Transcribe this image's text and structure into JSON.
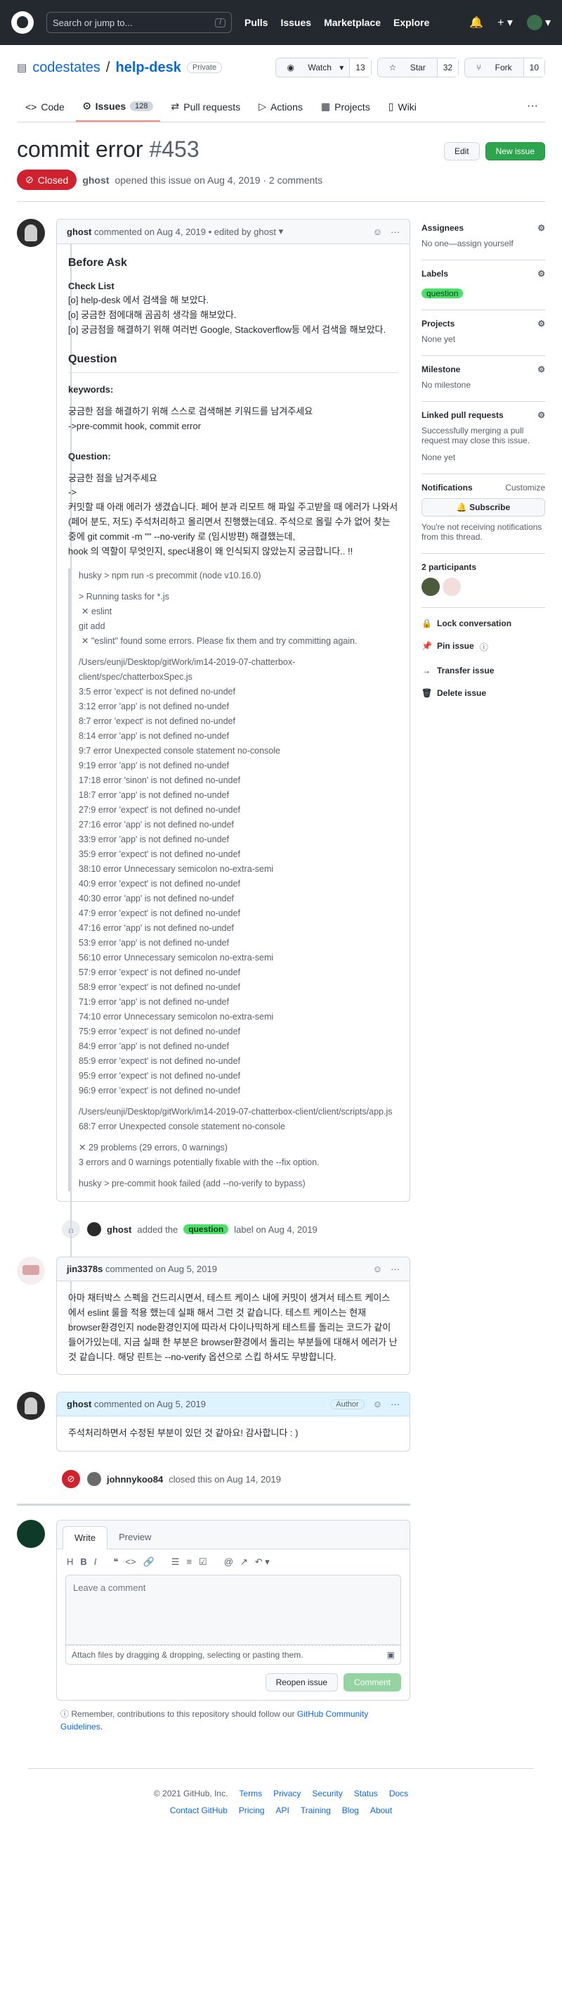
{
  "header": {
    "search_placeholder": "Search or jump to...",
    "search_key": "/",
    "nav": [
      "Pulls",
      "Issues",
      "Marketplace",
      "Explore"
    ]
  },
  "repo": {
    "owner": "codestates",
    "slash": "/",
    "name": "help-desk",
    "visibility": "Private",
    "watch_label": "Watch",
    "watch_count": "13",
    "star_label": "Star",
    "star_count": "32",
    "fork_label": "Fork",
    "fork_count": "10"
  },
  "tabs": [
    {
      "label": "Code",
      "icon": "code-icon"
    },
    {
      "label": "Issues",
      "icon": "issue-icon",
      "count": "128"
    },
    {
      "label": "Pull requests",
      "icon": "pull-request-icon"
    },
    {
      "label": "Actions",
      "icon": "play-icon"
    },
    {
      "label": "Projects",
      "icon": "project-icon"
    },
    {
      "label": "Wiki",
      "icon": "book-icon"
    }
  ],
  "issue": {
    "title": "commit error",
    "number": "#453",
    "edit_label": "Edit",
    "new_label": "New issue",
    "state": "Closed",
    "author": "ghost",
    "opened_text": "opened this issue on Aug 4, 2019 · 2 comments"
  },
  "first_comment": {
    "author": "ghost",
    "header_text": "commented on Aug 4, 2019 • edited by ghost",
    "h_before": "Before Ask",
    "checklist_title": "Check List",
    "checklist": [
      "[o] help-desk 에서 검색을 해 보았다.",
      "[o] 궁금한 점에대해 곰곰히 생각을 해보았다.",
      "[o] 궁금점을 해결하기 위해 여러번 Google, Stackoverflow등 에서 검색을 해보았다."
    ],
    "h_question": "Question",
    "keywords_label": "keywords:",
    "keywords_lines": [
      "궁금한 점을 해결하기 위해 스스로 검색해본 키워드를 남겨주세요",
      "->pre-commit hook, commit error"
    ],
    "question_label": "Question:",
    "question_lines": [
      "궁금한 점을 남겨주세요",
      "->",
      "커밋할 때 아래 에러가 생겼습니다. 페어 분과 리모트 해 파일 주고받을 때 에러가 나와서 (페어 분도, 저도) 주석처리하고 올리면서 진행했는데요. 주석으로 올릴 수가 없어 찾는 중에 git commit -m \"\" --no-verify 로 (임시방편) 해결했는데,",
      "hook 의 역할이 무엇인지, spec내용이 왜 인식되지 않았는지 궁금합니다.. !!"
    ],
    "quote": {
      "cmd": "husky > npm run -s precommit (node v10.16.0)",
      "task_lines": [
        "> Running tasks for *.js",
        "✕ eslint",
        "git add",
        "✕ \"eslint\" found some errors. Please fix them and try committing again."
      ],
      "file1": "/Users/eunji/Desktop/gitWork/im14-2019-07-chatterbox-client/spec/chatterboxSpec.js",
      "errors": [
        "3:5 error 'expect' is not defined no-undef",
        "3:12 error 'app' is not defined no-undef",
        "8:7 error 'expect' is not defined no-undef",
        "8:14 error 'app' is not defined no-undef",
        "9:7 error Unexpected console statement no-console",
        "9:19 error 'app' is not defined no-undef",
        "17:18 error 'sinon' is not defined no-undef",
        "18:7 error 'app' is not defined no-undef",
        "27:9 error 'expect' is not defined no-undef",
        "27:16 error 'app' is not defined no-undef",
        "33:9 error 'app' is not defined no-undef",
        "35:9 error 'expect' is not defined no-undef",
        "38:10 error Unnecessary semicolon no-extra-semi",
        "40:9 error 'expect' is not defined no-undef",
        "40:30 error 'app' is not defined no-undef",
        "47:9 error 'expect' is not defined no-undef",
        "47:16 error 'app' is not defined no-undef",
        "53:9 error 'app' is not defined no-undef",
        "56:10 error Unnecessary semicolon no-extra-semi",
        "57:9 error 'expect' is not defined no-undef",
        "58:9 error 'expect' is not defined no-undef",
        "71:9 error 'app' is not defined no-undef",
        "74:10 error Unnecessary semicolon no-extra-semi",
        "75:9 error 'expect' is not defined no-undef",
        "84:9 error 'app' is not defined no-undef",
        "85:9 error 'expect' is not defined no-undef",
        "95:9 error 'expect' is not defined no-undef",
        "96:9 error 'expect' is not defined no-undef"
      ],
      "file2": "/Users/eunji/Desktop/gitWork/im14-2019-07-chatterbox-client/client/scripts/app.js",
      "file2_error": "68:7 error Unexpected console statement no-console",
      "summary1": "✕ 29 problems (29 errors, 0 warnings)",
      "summary2": "3 errors and 0 warnings potentially fixable with the --fix option.",
      "hook_failed": "husky > pre-commit hook failed (add --no-verify to bypass)"
    }
  },
  "label_event": {
    "author": "ghost",
    "verb": "added the",
    "label": "question",
    "suffix": "label on Aug 4, 2019"
  },
  "comment2": {
    "author": "jin3378s",
    "header_text": "commented on Aug 5, 2019",
    "body": "아마 채터박스 스펙을 건드리시면서, 테스트 케이스 내에 커밋이 생겨서 테스트 케이스에서 eslint 룰을 적용 했는데 실패 해서 그런 것 같습니다. 테스트 케이스는 현재 browser환경인지 node환경인지에 따라서 다이나믹하게 테스트를 돌리는 코드가 같이 들어가있는데, 지금 실패 한 부분은 browser환경에서 돌리는 부분들에 대해서 에러가 난 것 같습니다. 해당 린트는 --no-verify 옵션으로 스킵 하셔도 무방합니다."
  },
  "comment3": {
    "author": "ghost",
    "header_text": "commented on Aug 5, 2019",
    "badge": "Author",
    "body": "주석처리하면서 수정된 부분이 있던 것 같아요! 감사합니다 : )"
  },
  "close_event": {
    "author": "johnnykoo84",
    "text": "closed this on Aug 14, 2019"
  },
  "editor": {
    "write": "Write",
    "preview": "Preview",
    "placeholder": "Leave a comment",
    "attach": "Attach files by dragging & dropping, selecting or pasting them.",
    "reopen": "Reopen issue",
    "comment": "Comment",
    "remind_pre": "Remember, contributions to this repository should follow our",
    "remind_link": "GitHub Community Guidelines."
  },
  "sidebar": {
    "assignees_title": "Assignees",
    "assignees_value": "No one—assign yourself",
    "labels_title": "Labels",
    "labels_value": "question",
    "projects_title": "Projects",
    "projects_value": "None yet",
    "milestone_title": "Milestone",
    "milestone_value": "No milestone",
    "linked_title": "Linked pull requests",
    "linked_desc": "Successfully merging a pull request may close this issue.",
    "linked_value": "None yet",
    "notif_title": "Notifications",
    "notif_customize": "Customize",
    "subscribe": "Subscribe",
    "notif_desc": "You're not receiving notifications from this thread.",
    "participants_title": "2 participants",
    "actions": [
      "Lock conversation",
      "Pin issue",
      "Transfer issue",
      "Delete issue"
    ]
  },
  "footer": {
    "copyright": "© 2021 GitHub, Inc.",
    "links1": [
      "Terms",
      "Privacy",
      "Security",
      "Status",
      "Docs"
    ],
    "links2": [
      "Contact GitHub",
      "Pricing",
      "API",
      "Training",
      "Blog",
      "About"
    ]
  },
  "colors": {
    "closed": "#cf222e",
    "green": "#2da44e",
    "label_question": "#4ce06a",
    "link": "#0969da"
  }
}
